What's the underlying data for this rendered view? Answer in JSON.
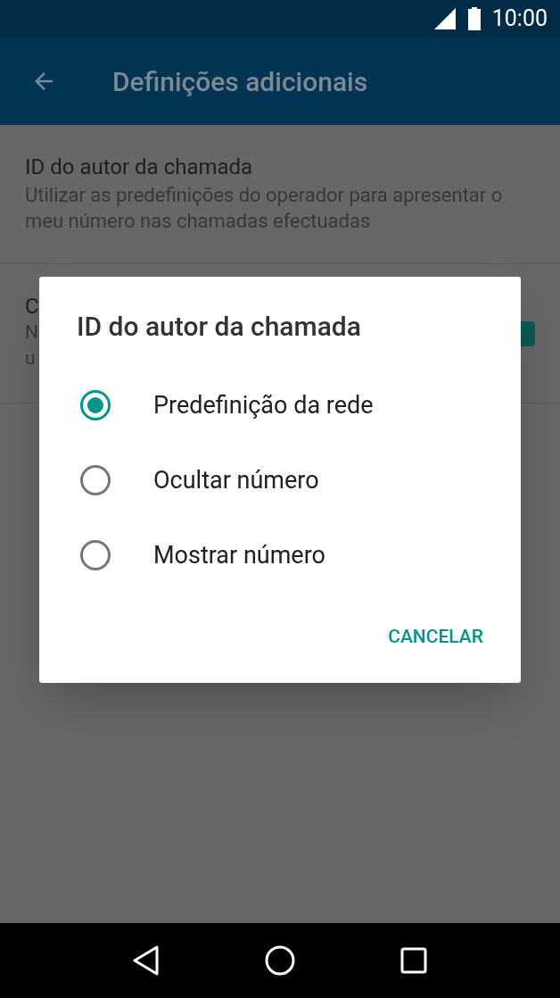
{
  "status_bar": {
    "time": "10:00"
  },
  "app_bar": {
    "title": "Definições adicionais"
  },
  "settings": [
    {
      "title": "ID do autor da chamada",
      "summary": "Utilizar as predefinições do operador para apresentar o meu número nas chamadas efectuadas"
    },
    {
      "title": "C",
      "summary_lines": [
        "N",
        "u"
      ],
      "switch": {
        "on": true
      }
    }
  ],
  "dialog": {
    "title": "ID do autor da chamada",
    "options": [
      {
        "label": "Predefinição da rede",
        "selected": true
      },
      {
        "label": "Ocultar número",
        "selected": false
      },
      {
        "label": "Mostrar número",
        "selected": false
      }
    ],
    "buttons": [
      "CANCELAR"
    ]
  }
}
